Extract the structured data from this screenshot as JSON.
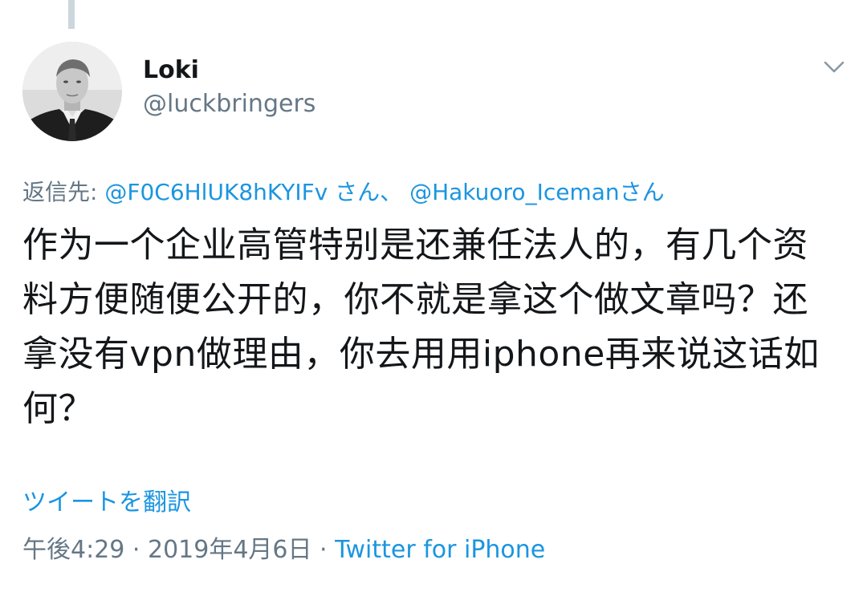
{
  "author": {
    "display_name": "Loki",
    "handle": "@luckbringers",
    "avatar_icon": "profile-photo"
  },
  "reply": {
    "prefix": "返信先: ",
    "mentions": [
      "@F0C6HlUK8hKYIFv",
      "@Hakuoro_Iceman"
    ],
    "suffix1": " さん、 ",
    "suffix2": "さん"
  },
  "tweet": {
    "text": "作为一个企业高管特别是还兼任法人的，有几个资料方便随便公开的，你不就是拿这个做文章吗？还拿没有vpn做理由，你去用用iphone再来说这话如何？"
  },
  "translate_label": "ツイートを翻訳",
  "meta": {
    "time": "午後4:29",
    "separator": " · ",
    "date": "2019年4月6日",
    "source": "Twitter for iPhone"
  },
  "colors": {
    "link": "#1b95e0",
    "secondary": "#657786",
    "primary": "#14171a",
    "thread_line": "#ccd6dd"
  },
  "icons": {
    "menu": "chevron-down-icon"
  }
}
